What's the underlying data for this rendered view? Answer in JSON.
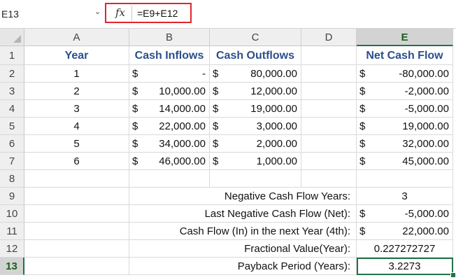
{
  "formula_bar": {
    "name_box": "E13",
    "fx_label": "fx",
    "formula": "=E9+E12"
  },
  "columns": [
    "A",
    "B",
    "C",
    "D",
    "E"
  ],
  "rows": [
    "1",
    "2",
    "3",
    "4",
    "5",
    "6",
    "7",
    "8",
    "9",
    "10",
    "11",
    "12",
    "13"
  ],
  "headers": {
    "year": "Year",
    "inflows": "Cash Inflows",
    "outflows": "Cash Outflows",
    "net": "Net Cash Flow"
  },
  "currency_symbol": "$",
  "data_rows": [
    {
      "year": "1",
      "inflow": "-",
      "outflow": "80,000.00",
      "net": "-80,000.00"
    },
    {
      "year": "2",
      "inflow": "10,000.00",
      "outflow": "12,000.00",
      "net": "-2,000.00"
    },
    {
      "year": "3",
      "inflow": "14,000.00",
      "outflow": "19,000.00",
      "net": "-5,000.00"
    },
    {
      "year": "4",
      "inflow": "22,000.00",
      "outflow": "3,000.00",
      "net": "19,000.00"
    },
    {
      "year": "5",
      "inflow": "34,000.00",
      "outflow": "2,000.00",
      "net": "32,000.00"
    },
    {
      "year": "6",
      "inflow": "46,000.00",
      "outflow": "1,000.00",
      "net": "45,000.00"
    }
  ],
  "summary": [
    {
      "label": "Negative Cash Flow Years:",
      "value": "3",
      "currency": ""
    },
    {
      "label": "Last Negative Cash Flow (Net):",
      "value": "-5,000.00",
      "currency": "$"
    },
    {
      "label": "Cash Flow (In) in the next Year (4th):",
      "value": "22,000.00",
      "currency": "$"
    },
    {
      "label": "Fractional Value(Year):",
      "value": "0.227272727",
      "currency": ""
    },
    {
      "label": "Payback Period (Years):",
      "value": "3.2273",
      "currency": ""
    }
  ],
  "active_cell": "E13",
  "colors": {
    "header_text": "#2b4f8c",
    "selection": "#217346",
    "formula_highlight": "#e0262b"
  }
}
